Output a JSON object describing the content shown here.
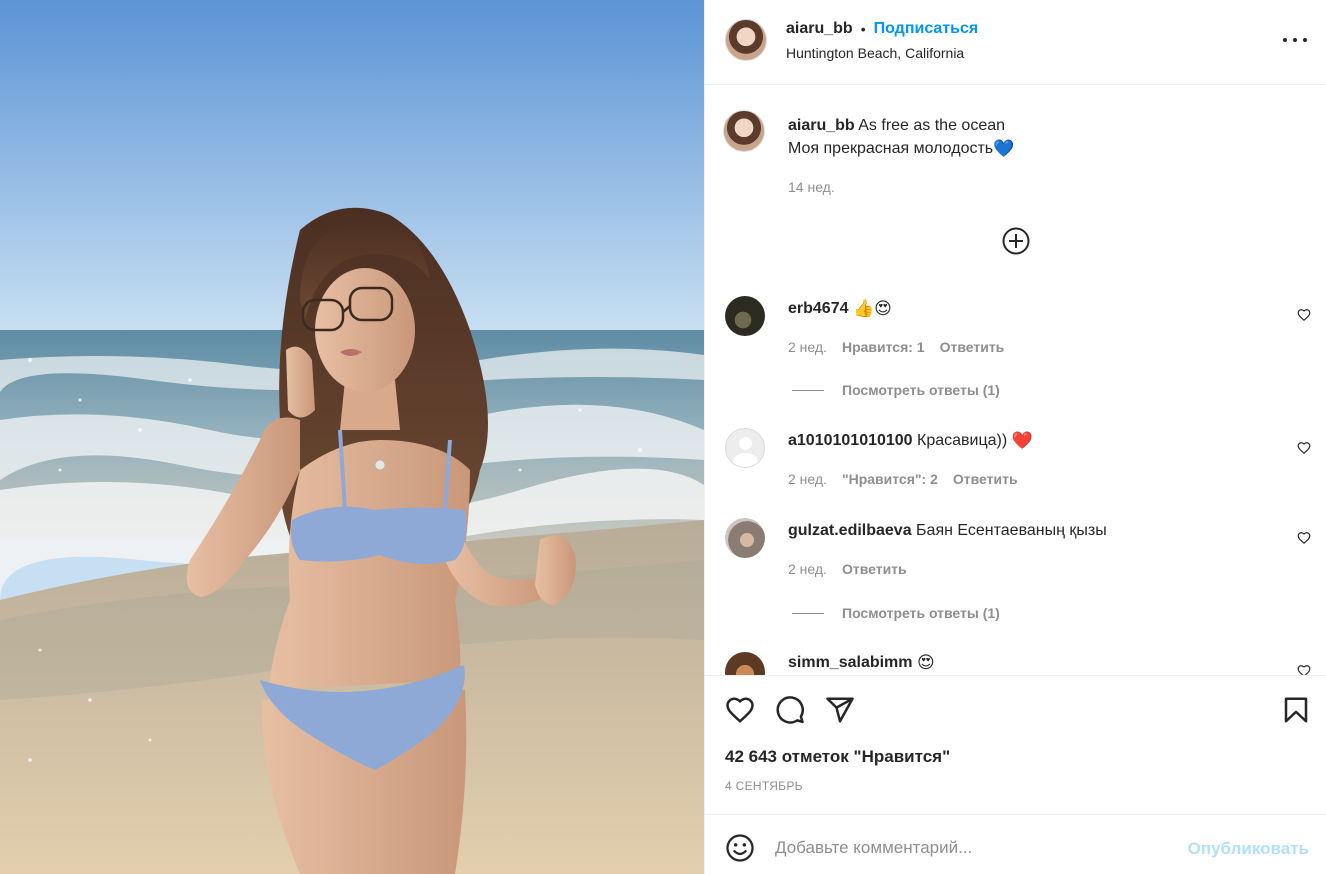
{
  "header": {
    "username": "aiaru_bb",
    "separator": "•",
    "follow_label": "Подписаться",
    "location": "Huntington Beach, California"
  },
  "caption": {
    "username": "aiaru_bb",
    "line1": "As free as the ocean",
    "line2": "Моя прекрасная молодость",
    "line2_emoji": "💙",
    "time": "14 нед."
  },
  "comments": [
    {
      "username": "erb4674",
      "text": "",
      "emoji": "👍😍",
      "time": "2 нед.",
      "likes": "Нравится: 1",
      "reply": "Ответить",
      "view_replies": "Посмотреть ответы (1)"
    },
    {
      "username": "a1010101010100",
      "text": "Красавица))",
      "emoji": "❤️",
      "time": "2 нед.",
      "likes": "\"Нравится\": 2",
      "reply": "Ответить"
    },
    {
      "username": "gulzat.edilbaeva",
      "text": "Баян Есентаеваның қызы",
      "time": "2 нед.",
      "reply": "Ответить",
      "view_replies": "Посмотреть ответы (1)"
    },
    {
      "username": "simm_salabimm",
      "emoji": "😍"
    }
  ],
  "actions": {
    "icons": [
      "heart-icon",
      "comment-icon",
      "share-icon",
      "bookmark-icon"
    ],
    "likes_count": "42 643 отметок \"Нравится\"",
    "date": "4 СЕНТЯБРЬ"
  },
  "form": {
    "placeholder": "Добавьте комментарий...",
    "publish_label": "Опубликовать"
  },
  "colors": {
    "accent": "#0095f6",
    "publish_disabled": "#b2dffc",
    "muted": "#8e8e8e",
    "text": "#262626",
    "divider": "#efefef"
  }
}
